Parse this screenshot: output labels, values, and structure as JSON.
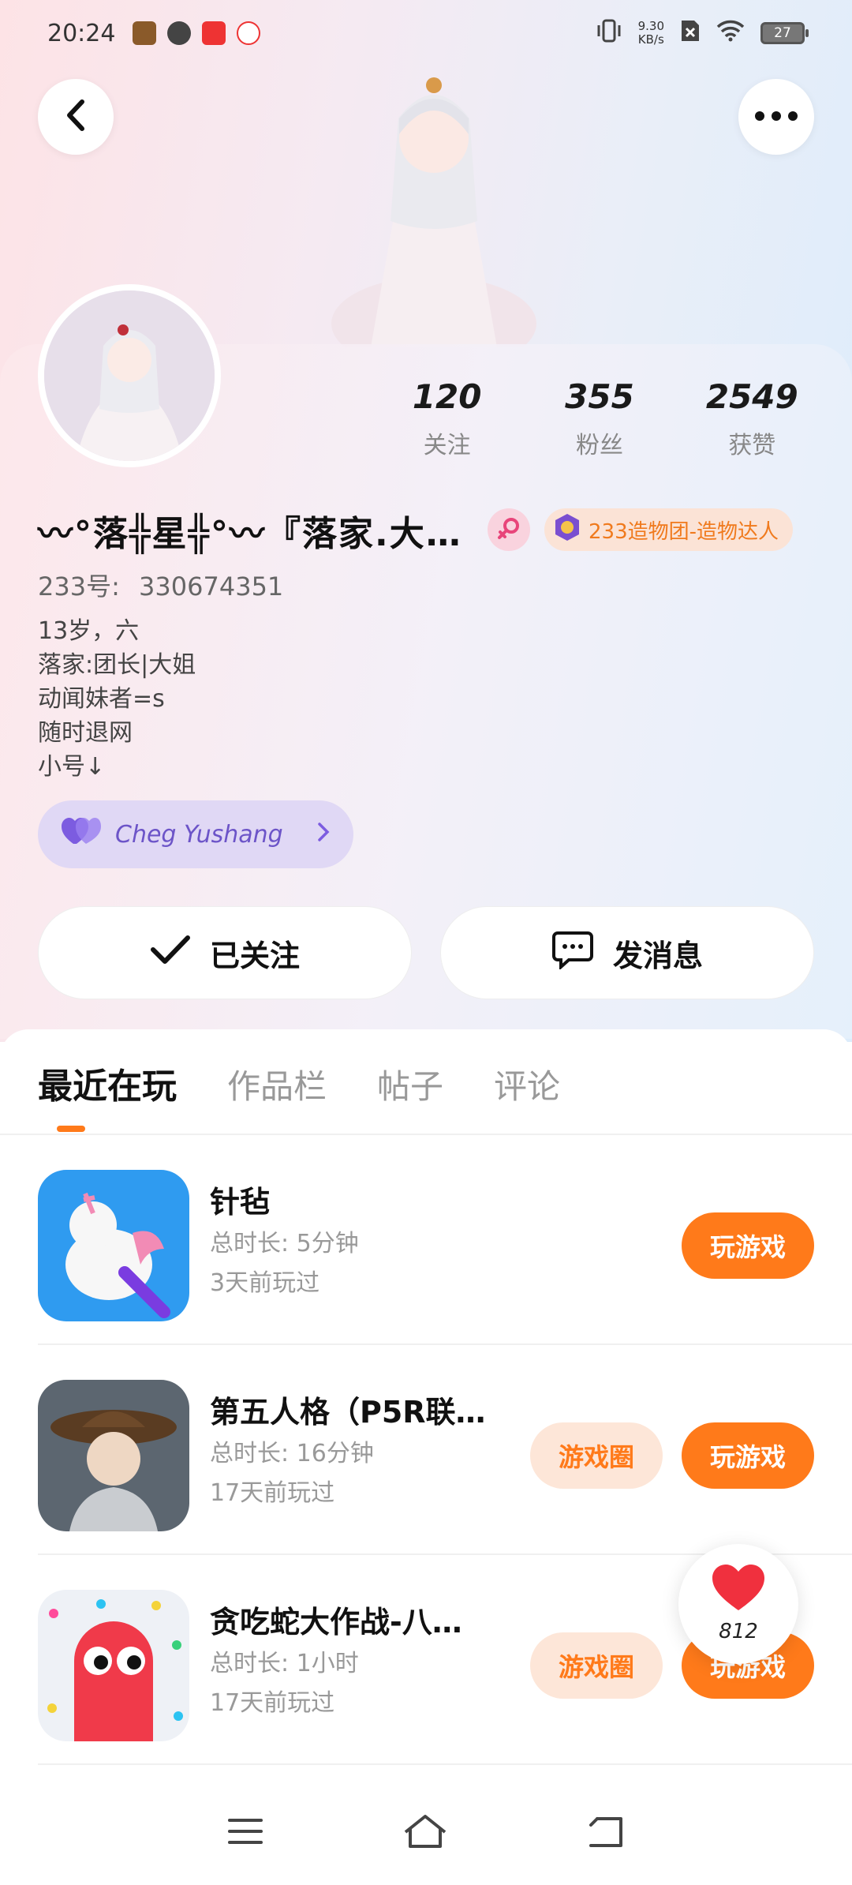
{
  "status_bar": {
    "time": "20:24",
    "net_speed_value": "9.30",
    "net_speed_unit": "KB/s",
    "battery": "27"
  },
  "profile": {
    "stats": [
      {
        "value": "120",
        "label": "关注"
      },
      {
        "value": "355",
        "label": "粉丝"
      },
      {
        "value": "2549",
        "label": "获赞"
      }
    ],
    "nickname": "〰°落╬星╬°〰『落家.大…",
    "title_badge": "233造物团-造物达人",
    "uid_label": "233号:",
    "uid_value": "330674351",
    "bio": "13岁，六\n落家:团长|大姐\n动闻妹者=s\n随时退网\n小号↓",
    "cp_name": "Cheg Yushang",
    "follow_button": "已关注",
    "message_button": "发消息"
  },
  "tabs": [
    {
      "label": "最近在玩",
      "active": true
    },
    {
      "label": "作品栏",
      "active": false
    },
    {
      "label": "帖子",
      "active": false
    },
    {
      "label": "评论",
      "active": false
    }
  ],
  "games": [
    {
      "title": "针毡",
      "duration": "总时长:  5分钟",
      "last_played": "3天前玩过",
      "circle_button": "",
      "play_button": "玩游戏"
    },
    {
      "title": "第五人格（P5R联…",
      "duration": "总时长:  16分钟",
      "last_played": "17天前玩过",
      "circle_button": "游戏圈",
      "play_button": "玩游戏"
    },
    {
      "title": "贪吃蛇大作战-八…",
      "duration": "总时长:  1小时",
      "last_played": "17天前玩过",
      "circle_button": "游戏圈",
      "play_button": "玩游戏"
    }
  ],
  "floating_like": {
    "count": "812"
  },
  "colors": {
    "accent": "#ff7a1a",
    "accent_light": "#fde6d8",
    "cp_purple": "#6c54c8",
    "heart_red": "#f0303e"
  }
}
